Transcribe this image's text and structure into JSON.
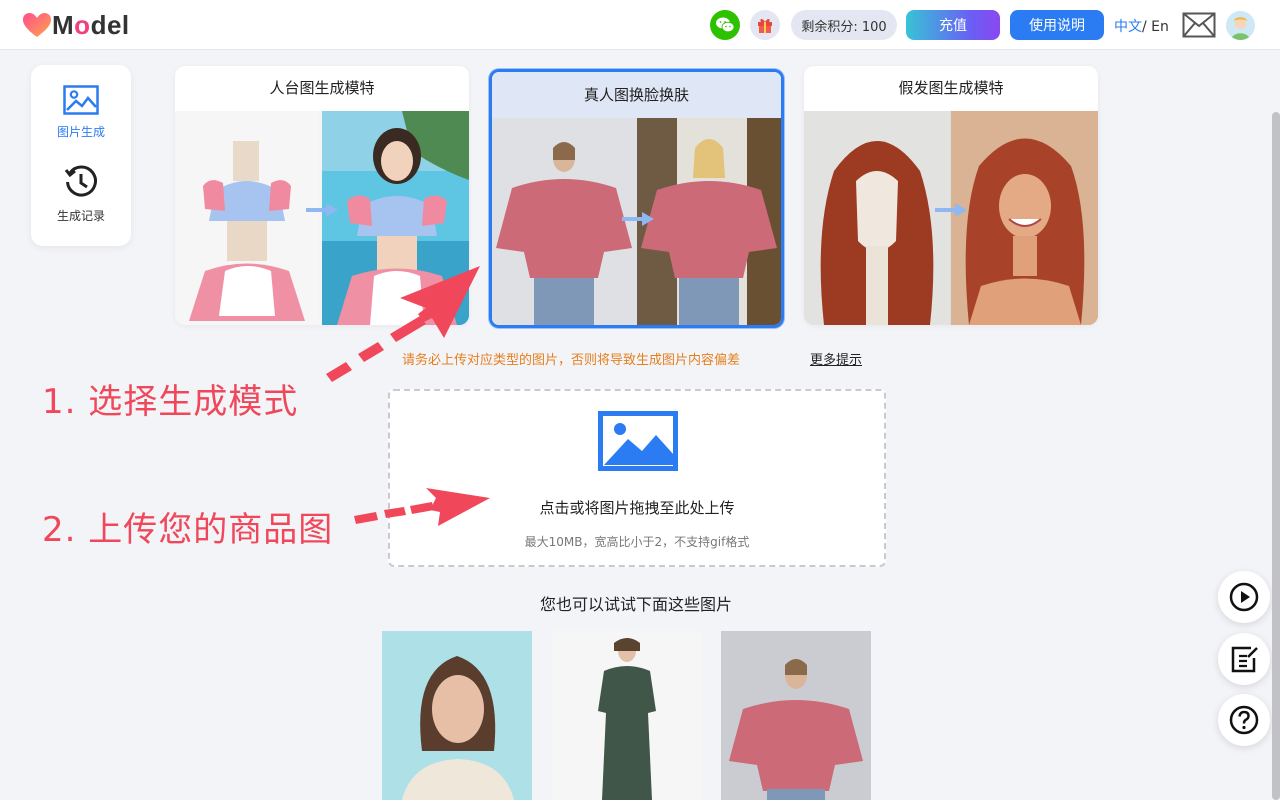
{
  "header": {
    "logo_text": "Model",
    "points_label": "剩余积分: 100",
    "recharge_label": "充值",
    "guide_label": "使用说明",
    "lang_zh": "中文",
    "lang_sep": "/ ",
    "lang_en": "En"
  },
  "sidebar": {
    "items": [
      {
        "label": "图片生成",
        "icon": "image-icon"
      },
      {
        "label": "生成记录",
        "icon": "history-icon"
      }
    ]
  },
  "modes": [
    {
      "title": "人台图生成模特"
    },
    {
      "title": "真人图换脸换肤",
      "selected": true
    },
    {
      "title": "假发图生成模特"
    }
  ],
  "warning": "请务必上传对应类型的图片，否则将导致生成图片内容偏差",
  "more_tips": "更多提示",
  "upload": {
    "text": "点击或将图片拖拽至此处上传",
    "sub": "最大10MB，宽高比小于2，不支持gif格式"
  },
  "annotations": {
    "step1": "1. 选择生成模式",
    "step2": "2. 上传您的商品图"
  },
  "samples_title": "您也可以试试下面这些图片",
  "colors": {
    "accent": "#2b7cf2",
    "warning": "#e57f1e",
    "annotation": "#f0485a"
  }
}
